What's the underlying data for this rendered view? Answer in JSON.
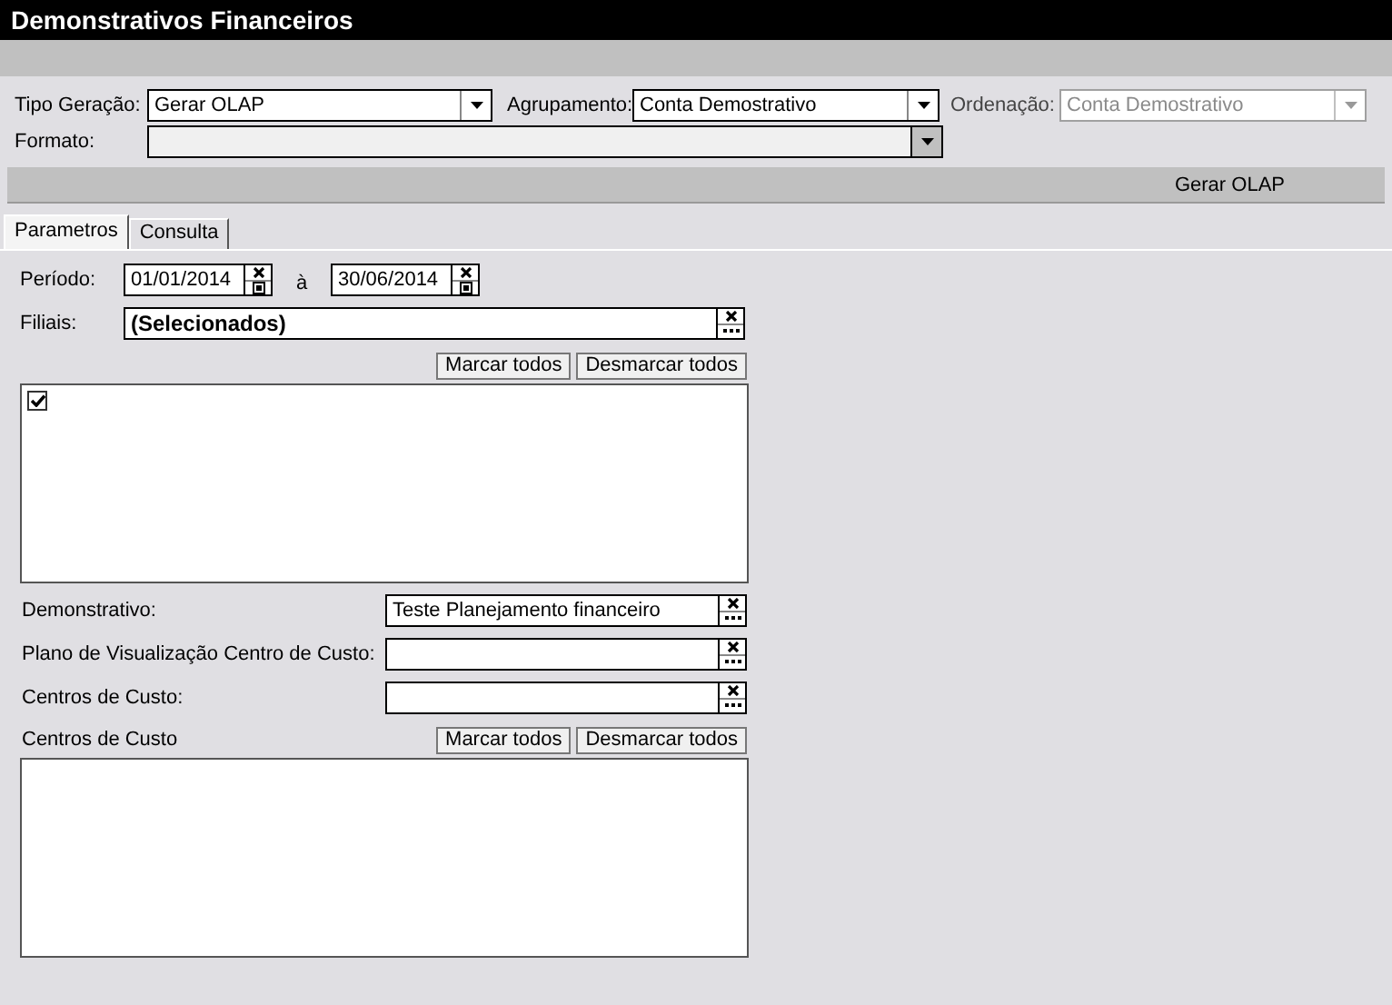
{
  "window": {
    "title": "Demonstrativos Financeiros"
  },
  "filters": [
    {
      "label": "Tipo Geração:",
      "value": "Gerar OLAP",
      "disabled": false
    },
    {
      "label": "Agrupamento:",
      "value": "Conta Demostrativo",
      "disabled": false
    },
    {
      "label": "Ordenação:",
      "value": "Conta Demostrativo",
      "disabled": true
    },
    {
      "label": "Formato:",
      "disabled": false,
      "kind": "readonly"
    }
  ],
  "action_bar": {
    "label": "Gerar OLAP"
  },
  "tabs": [
    {
      "label": "Parametros",
      "selected": true
    },
    {
      "label": "Consulta",
      "selected": false
    }
  ],
  "period": {
    "label": "Período:",
    "from": "01/01/2014",
    "separator": "à",
    "to": "30/06/2014"
  },
  "branches": {
    "label": "Filiais:",
    "value": "(Selecionados)"
  },
  "branch_list": {
    "buttons": [
      "Marcar todos",
      "Desmarcar todos"
    ],
    "items": [
      {
        "checked": true
      }
    ]
  },
  "lookups": [
    {
      "label": "Demonstrativo:",
      "value": "Teste Planejamento financeiro"
    },
    {
      "label": "Plano de Visualização Centro de Custo:"
    },
    {
      "label": "Centros de Custo:"
    }
  ],
  "cost_centers": {
    "label": "Centros de Custo",
    "buttons": [
      "Marcar todos",
      "Desmarcar todos"
    ]
  }
}
